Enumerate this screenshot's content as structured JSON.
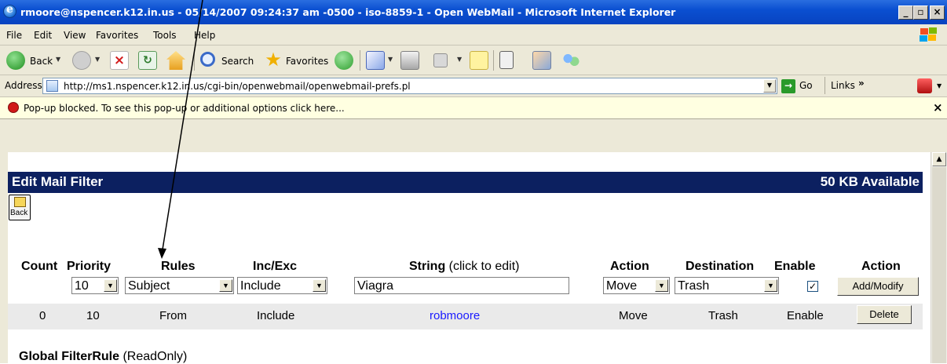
{
  "window": {
    "title": "rmoore@nspencer.k12.in.us - 05/14/2007 09:24:37 am -0500 - iso-8859-1 - Open WebMail - Microsoft Internet Explorer"
  },
  "menu": [
    "File",
    "Edit",
    "View",
    "Favorites",
    "Tools",
    "Help"
  ],
  "toolbar": {
    "back_label": "Back",
    "search_label": "Search",
    "favorites_label": "Favorites"
  },
  "address": {
    "label": "Address",
    "url": "http://ms1.nspencer.k12.in.us/cgi-bin/openwebmail/openwebmail-prefs.pl",
    "go_label": "Go",
    "links_label": "Links"
  },
  "infobar": {
    "message": "Pop-up blocked. To see this pop-up or additional options click here...",
    "close": "×"
  },
  "page": {
    "title": "Edit Mail Filter",
    "quota": "50 KB Available",
    "back_button_label": "Back",
    "columns": {
      "count": "Count",
      "priority": "Priority",
      "rules": "Rules",
      "incexc": "Inc/Exc",
      "string": "String",
      "string_hint": "(click to edit)",
      "action": "Action",
      "destination": "Destination",
      "enable": "Enable",
      "action2": "Action"
    },
    "form": {
      "priority": "10",
      "rule": "Subject",
      "incexc": "Include",
      "string_value": "Viagra",
      "action": "Move",
      "destination": "Trash",
      "enabled": true,
      "submit_label": "Add/Modify"
    },
    "rows": [
      {
        "count": "0",
        "priority": "10",
        "rule": "From",
        "incexc": "Include",
        "string": "robmoore",
        "action": "Move",
        "destination": "Trash",
        "enable": "Enable",
        "button": "Delete"
      }
    ],
    "global_heading": "Global FilterRule",
    "global_heading_suffix": "(ReadOnly)"
  },
  "colors": {
    "header_bar": "#0c2060",
    "link": "#1a1aff",
    "titlebar": "#0a4fd1"
  }
}
